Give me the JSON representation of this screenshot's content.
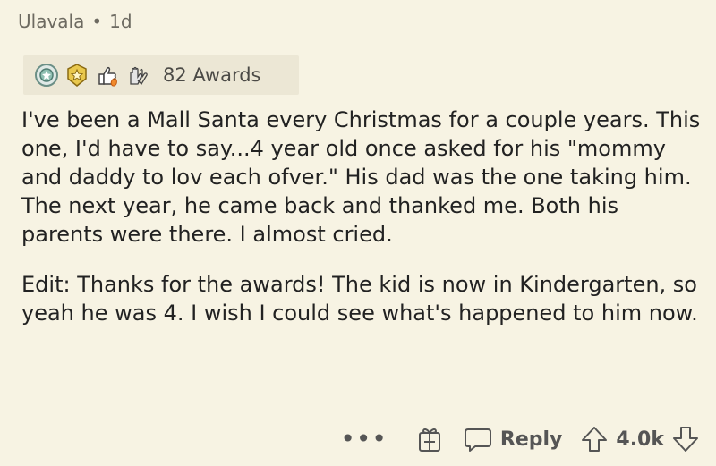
{
  "header": {
    "username": "Ulavala",
    "separator": "•",
    "time": "1d"
  },
  "awards": {
    "icons": [
      "award-medal-icon",
      "award-star-badge-icon",
      "thumbs-up-fire-icon",
      "hands-up-icon"
    ],
    "label": "82 Awards"
  },
  "post": {
    "paragraph_1": "I've been a Mall Santa every Christmas for a couple years. This one, I'd have to say...4 year old once asked for his \"mommy and daddy to lov each ofver.\" His dad was the one taking him. The next year, he came back and thanked me. Both his parents were there. I almost cried.",
    "paragraph_2": "Edit: Thanks for the awards! The kid is now in Kindergarten, so yeah he was 4. I wish I could see what's happened to him now."
  },
  "actions": {
    "more": "•••",
    "reply_label": "Reply",
    "score": "4.0k"
  },
  "colors": {
    "background": "#f7f3e3",
    "awards_bg": "#ece7d5",
    "text": "#222222",
    "muted": "#6d6a61"
  }
}
